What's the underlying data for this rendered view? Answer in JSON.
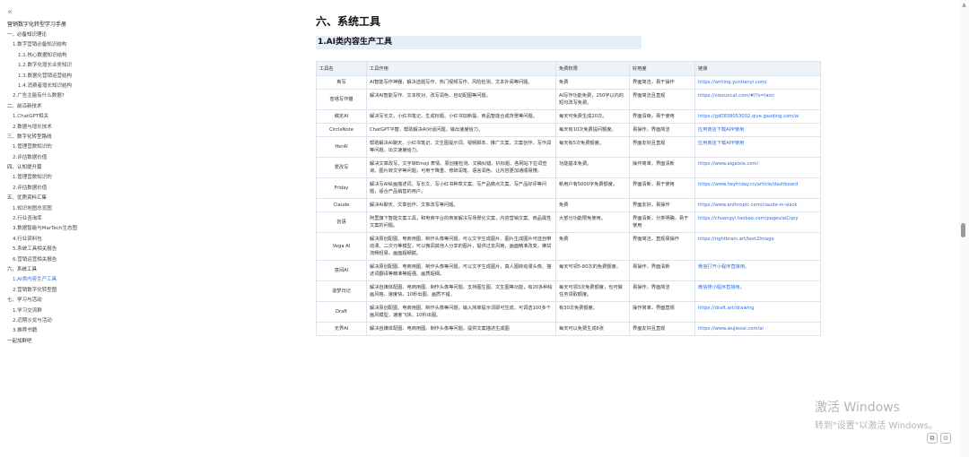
{
  "sidebar": {
    "collapse_icon": "«",
    "title": "营销数字化转型学习手册",
    "items": [
      {
        "label": "一、必备知识理论",
        "level": 1,
        "active": false
      },
      {
        "label": "1.数字营销必备知识结构",
        "level": 2,
        "active": false
      },
      {
        "label": "1.1.核心数据知识结构",
        "level": 3,
        "active": false
      },
      {
        "label": "1.2.数字化增长业务知识",
        "level": 3,
        "active": false
      },
      {
        "label": "1.3.数据化营销运营结构",
        "level": 3,
        "active": false
      },
      {
        "label": "1.4.消费者增长知识结构",
        "level": 3,
        "active": false
      },
      {
        "label": "2.广告主能有什么数据?",
        "level": 2,
        "active": false
      },
      {
        "label": "二、前沿新技术",
        "level": 1,
        "active": false
      },
      {
        "label": "1.ChatGPT相关",
        "level": 2,
        "active": false
      },
      {
        "label": "2.数据与增长技术",
        "level": 2,
        "active": false
      },
      {
        "label": "三、数字化转型路线",
        "level": 1,
        "active": false
      },
      {
        "label": "1.管理营数知识的",
        "level": 2,
        "active": false
      },
      {
        "label": "2.评估数据价值",
        "level": 2,
        "active": false
      },
      {
        "label": "四、认知提升篇",
        "level": 1,
        "active": false
      },
      {
        "label": "1.管理营数知识的",
        "level": 2,
        "active": false
      },
      {
        "label": "2.评估数据价值",
        "level": 2,
        "active": false
      },
      {
        "label": "五、优质资料汇集",
        "level": 1,
        "active": false
      },
      {
        "label": "1.知识地图总览图",
        "level": 2,
        "active": false
      },
      {
        "label": "2.行业咨询库",
        "level": 2,
        "active": false
      },
      {
        "label": "3.数据智能与MarTech生态图",
        "level": 2,
        "active": false
      },
      {
        "label": "4.行业资料包",
        "level": 2,
        "active": false
      },
      {
        "label": "5.系统工具相关报告",
        "level": 2,
        "active": false
      },
      {
        "label": "6.营销运营相关报告",
        "level": 2,
        "active": false
      },
      {
        "label": "六、系统工具",
        "level": 1,
        "active": false
      },
      {
        "label": "1.AI类内容生产工具",
        "level": 2,
        "active": true
      },
      {
        "label": "2.营销数字化转型图",
        "level": 2,
        "active": false
      },
      {
        "label": "七、学习与活动",
        "level": 1,
        "active": false
      },
      {
        "label": "1.学习交流群",
        "level": 2,
        "active": false
      },
      {
        "label": "2.近期沙龙与活动",
        "level": 2,
        "active": false
      },
      {
        "label": "3.推荐书籍",
        "level": 2,
        "active": false
      },
      {
        "label": "一起加群吧",
        "level": 1,
        "active": false
      }
    ]
  },
  "content": {
    "h1": "六、系统工具",
    "h2": "1.AI类内容生产工具",
    "table": {
      "headers": [
        "工具名",
        "工具作用",
        "免费权限",
        "好用度",
        "链接"
      ],
      "rows": [
        [
          "爽写",
          "AI智能写作神器，解决选题写作、热门视频写作、风险检测、文本补阅等问题。",
          "免费",
          "界面简洁，易于操作",
          "https://writing.yuntianyi.com/"
        ],
        [
          "密塔写作猫",
          "解决AI智能写作、文本校对、改写润色、自动配图等问题。",
          "AI写作功能免费，250字以内的短句改写免费。",
          "界面简洁且直观",
          "https://xiezuocat.com/#/?s=laon"
        ],
        [
          "稿定AI",
          "解决写长文，小红书笔记、生成标题、小红书加新提、商品智能合成背景等问题。",
          "每天可免费生成20次。",
          "界面清晰，易于使用",
          "https://gd0838053002.qiye.gaoding.com/ai"
        ],
        [
          "CircleNote",
          "ChatGPT平替，帮助解决AI对话问题，输出速度给力。",
          "每天有10次免费提问额度。",
          "易操作，界面简洁",
          "应用商店下载APP使用"
        ],
        [
          "HerAI",
          "帮助解决AI聊天、小红书笔记、文生图提示词、视频脚本、推广文案、文案创作、写作润等问题，出文速度给力。",
          "每天有5次免费额度。",
          "界面友好且直观",
          "应用商店下载APP使用"
        ],
        [
          "爱改写",
          "解决文章改写、文字转Emoji 表情、原创度检测、文稿纠错、扒标题、各网站下拉词查询、图片转文字等问题，可用于降重、修辞润笔、语言润色、让内容更加通顺易懂。",
          "功能基本免费。",
          "操作简单，界面清新",
          "https://www.aigaixie.com/"
        ],
        [
          "Friday",
          "解决写AI绘画描述词、写长文、写小红书种草文案、写产品痛点文案、写产品好评等问题，适合产品销售的用户。",
          "新用户有5000字免费额度。",
          "界面清新，易于使用",
          "https://www.heyfriday.cn/article/dashboard"
        ],
        [
          "Claude",
          "解决AI聊天、文章创作、文章改写等问题。",
          "免费",
          "界面友好，易操作",
          "https://www.anthropic.com/claude-in-slack"
        ],
        [
          "创语",
          "阿里旗下智能文案工具，和电商平台的商家解决写场景化文案，内容营销文案、商品属性文案的问题。",
          "大部分功能限免使用。",
          "界面清新，分类明确，易于使用",
          "https://chuangyi.taobao.com/pages/aiCopy"
        ],
        [
          "Vega AI",
          "解决原创配图、电商用图、制作头像等问题，可以文字生成图片、图片生成图片可选自带动漫、二次元等模型，可以微调其他人分享的图片，提供过去风格，画面精准改变，拂拭流畅轻易，画面超细腻。",
          "免费",
          "界面简洁，直观易操作",
          "https://rightbrain.art/text2Image"
        ],
        [
          "意间AI",
          "解决原创配图、电商用图、制作头像等问题，可以文字生成图片、真人图转动漫头像、描述词翻译等精准等超强、画质超细。",
          "每天可领5-80次的免费额度。",
          "易操作，界面清新",
          "微信打开小程序直接用。"
        ],
        [
          "造梦日记",
          "解决自媒体配图、电商用图、制作头像等问题，支持图生图、文生图等功能，有20多种绘画风格，速度快，10秒出图，画质不错。",
          "每天可领3次免费额度，也可做任务领取额度。",
          "易操作，界面简洁",
          "微信搜小程序直接用。"
        ],
        [
          "Draft",
          "解决原创配图、电商用图、制作头像等问题，输入简单提示词即可生成，可调选100多个画风模型，速度飞快，10秒出图。",
          "有30次免费额度。",
          "操作简单，界面直观",
          "https://draft.art/drawing"
        ],
        [
          "无界AI",
          "解决自媒体配图、电商用图、制作头像等问题，提供文案描述生成图",
          "每天可以免费生成6张",
          "界面友好且直观",
          "https://www.wujiexai.com/ai"
        ]
      ]
    }
  },
  "watermark": {
    "line1": "激活 Windows",
    "line2": "转到\"设置\"以激活 Windows。"
  },
  "corner": {
    "btn1_icon": "⧉",
    "btn2_icon": "⊙"
  }
}
